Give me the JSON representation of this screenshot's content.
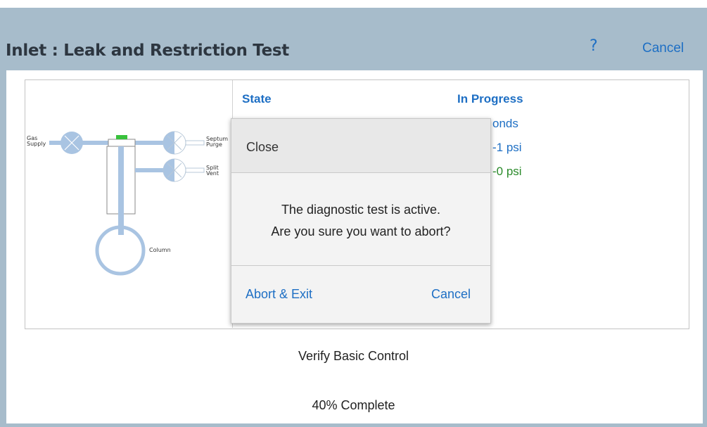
{
  "header": {
    "title": "Inlet : Leak and Restriction Test",
    "help_icon": "?",
    "cancel_label": "Cancel"
  },
  "diagram": {
    "labels": {
      "gas_supply_line1": "Gas",
      "gas_supply_line2": "Supply",
      "septum_purge_line1": "Septum",
      "septum_purge_line2": "Purge",
      "split_vent_line1": "Split",
      "split_vent_line2": "Vent",
      "column": "Column"
    }
  },
  "status": {
    "label": "State",
    "value": "In Progress",
    "peek_lines": [
      "onds",
      "-1 psi",
      "-0 psi"
    ]
  },
  "dialog": {
    "title": "Close",
    "message_line1": "The diagnostic test is active.",
    "message_line2": "Are you sure you want to abort?",
    "abort_label": "Abort & Exit",
    "cancel_label": "Cancel"
  },
  "footer": {
    "step": "Verify Basic Control",
    "progress_text": "40% Complete",
    "progress_fraction": 0.4
  },
  "colors": {
    "header_bg": "#a7bccb",
    "accent_blue": "#1e6fc4",
    "pipe_blue": "#a9c4e2",
    "green_marker": "#39c23c",
    "pressure_green": "#2a8a2a"
  }
}
